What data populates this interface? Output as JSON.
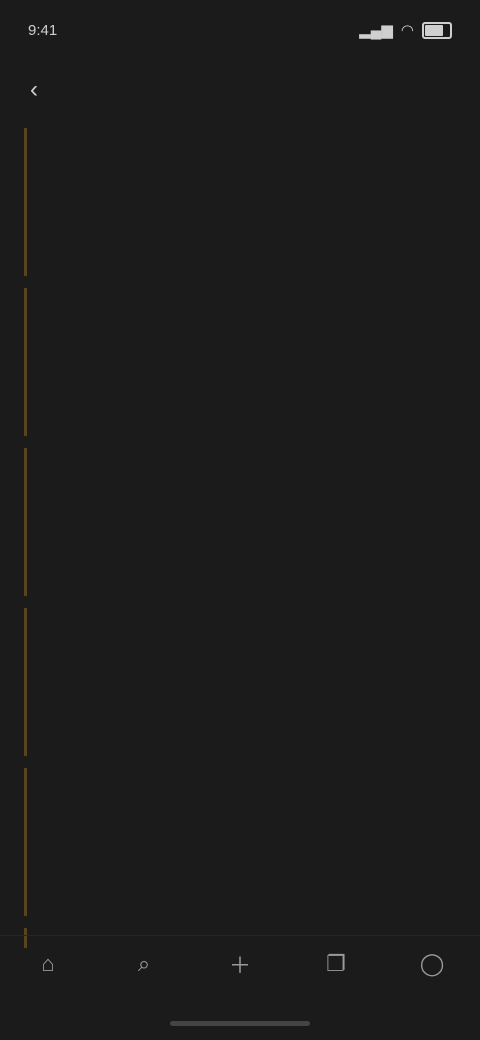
{
  "status_bar": {
    "time": "9:41",
    "signal_icon": "signal-icon",
    "wifi_icon": "wifi-icon",
    "battery_icon": "battery-icon"
  },
  "header": {
    "back_icon": "back-arrow-icon",
    "title": ""
  },
  "list": {
    "items": [
      {
        "text": "",
        "meta": ""
      },
      {
        "text": "",
        "meta": ""
      },
      {
        "text": "",
        "meta": ""
      },
      {
        "text": "",
        "meta": ""
      },
      {
        "text": "",
        "meta": ""
      },
      {
        "text": "",
        "meta": ""
      }
    ]
  },
  "nav": {
    "items": [
      {
        "icon": "home-icon"
      },
      {
        "icon": "search-icon"
      },
      {
        "icon": "add-icon"
      },
      {
        "icon": "bookmark-icon"
      },
      {
        "icon": "profile-icon"
      }
    ]
  },
  "colors": {
    "background": "#1b1b1b",
    "accent": "#b08840",
    "accent_border": "#5a4420",
    "text": "#d2d2d2"
  }
}
